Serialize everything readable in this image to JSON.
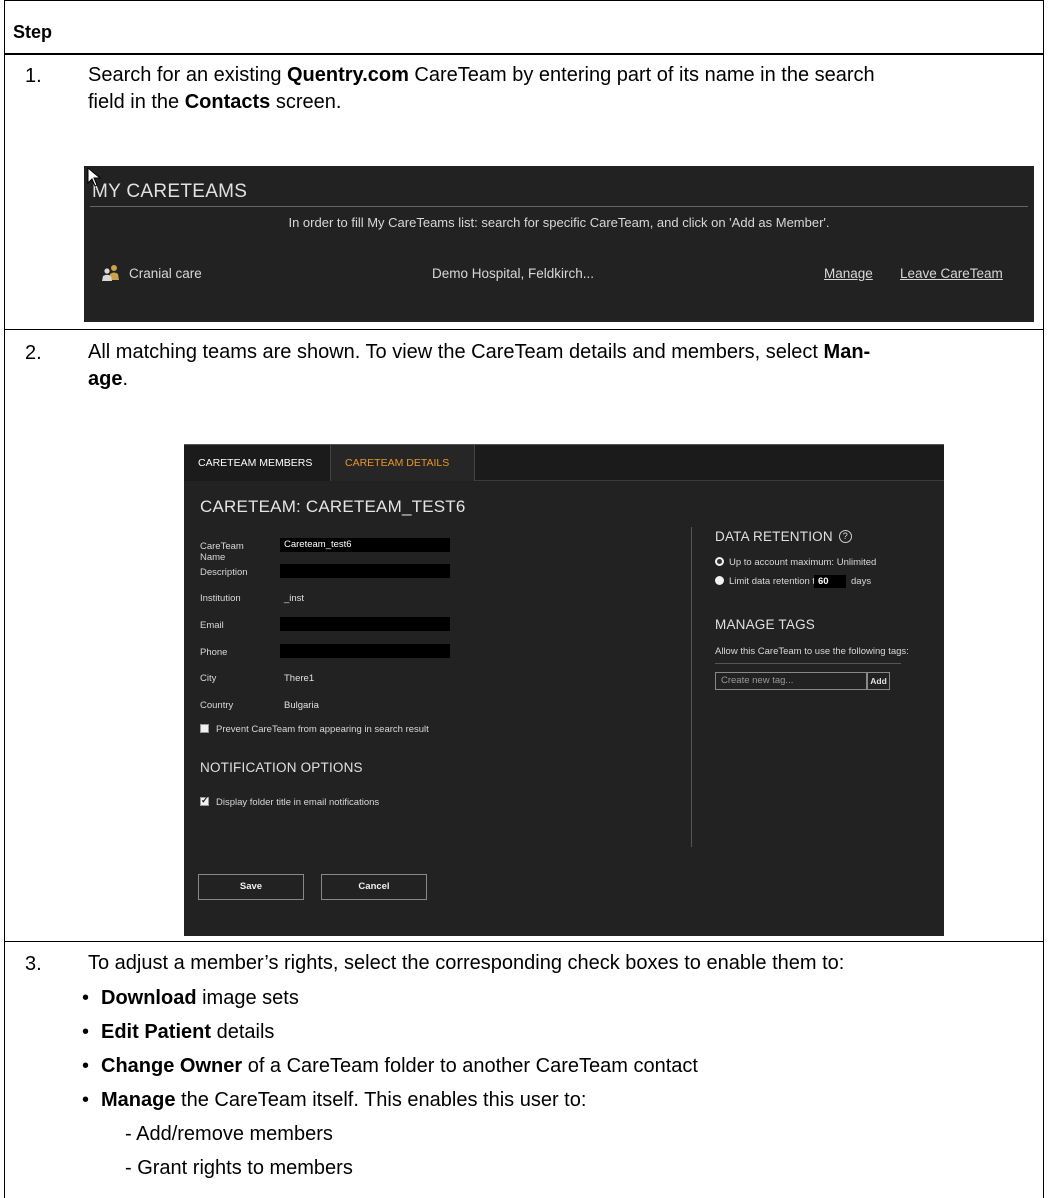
{
  "table": {
    "header": "Step"
  },
  "steps": [
    {
      "num": "1.",
      "text_a": "Search for an existing ",
      "text_b": "Quentry.com",
      "text_c": " CareTeam by entering part of its name in the search",
      "line2_a": "field in the ",
      "line2_b": "Contacts",
      "line2_c": " screen."
    },
    {
      "num": "2.",
      "text_a": "All matching teams are shown. To view the CareTeam details and members, select ",
      "text_b": "Man-",
      "line2_b": "age",
      "line2_c": "."
    },
    {
      "num": "3.",
      "text": "To adjust a member’s rights, select the corresponding check boxes to enable them to:",
      "bullets": [
        {
          "bold": "Download",
          "rest": " image sets"
        },
        {
          "bold": "Edit Patient",
          "rest": " details"
        },
        {
          "bold": "Change Owner",
          "rest": " of a CareTeam folder to another CareTeam contact"
        },
        {
          "bold": "Manage",
          "rest": " the CareTeam itself. This enables this user to:"
        }
      ],
      "subitems": [
        "- Add/remove members",
        "- Grant rights to members"
      ]
    }
  ],
  "my_careteams": {
    "title": "MY CARETEAMS",
    "hint": "In order to fill My CareTeams list: search for specific CareTeam, and click on 'Add as Member'.",
    "row": {
      "name": "Cranial care",
      "institution": "Demo Hospital, Feldkirch...",
      "manage_link": "Manage",
      "leave_link": "Leave CareTeam"
    }
  },
  "careteam_details": {
    "tabs": [
      "CARETEAM MEMBERS",
      "CARETEAM DETAILS"
    ],
    "active_tab": "CARETEAM DETAILS",
    "title": "CARETEAM: CARETEAM_TEST6",
    "fields": {
      "name_label": "CareTeam Name",
      "name_value": "Careteam_test6",
      "description_label": "Description",
      "description_value": "",
      "institution_label": "Institution",
      "institution_value": "_inst",
      "email_label": "Email",
      "email_value": "",
      "phone_label": "Phone",
      "phone_value": "",
      "city_label": "City",
      "city_value": "There1",
      "country_label": "Country",
      "country_value": "Bulgaria"
    },
    "prevent_search_label": "Prevent CareTeam from appearing in search result",
    "prevent_search_checked": false,
    "notification_title": "NOTIFICATION OPTIONS",
    "display_folder_label": "Display folder title in email notifications",
    "display_folder_checked": true,
    "data_retention": {
      "title": "DATA RETENTION",
      "option_max": "Up to account maximum: Unlimited",
      "option_limit": "Limit data retention to",
      "days_value": "60",
      "days_label": "days",
      "selected": "option_max"
    },
    "manage_tags": {
      "title": "MANAGE TAGS",
      "hint": "Allow this CareTeam to use the following tags:",
      "placeholder": "Create new tag...",
      "add_label": "Add"
    },
    "save_label": "Save",
    "cancel_label": "Cancel"
  },
  "colors": {
    "dark_bg": "#222222",
    "accent": "#e8962a",
    "text_light": "#d8d8d8"
  }
}
